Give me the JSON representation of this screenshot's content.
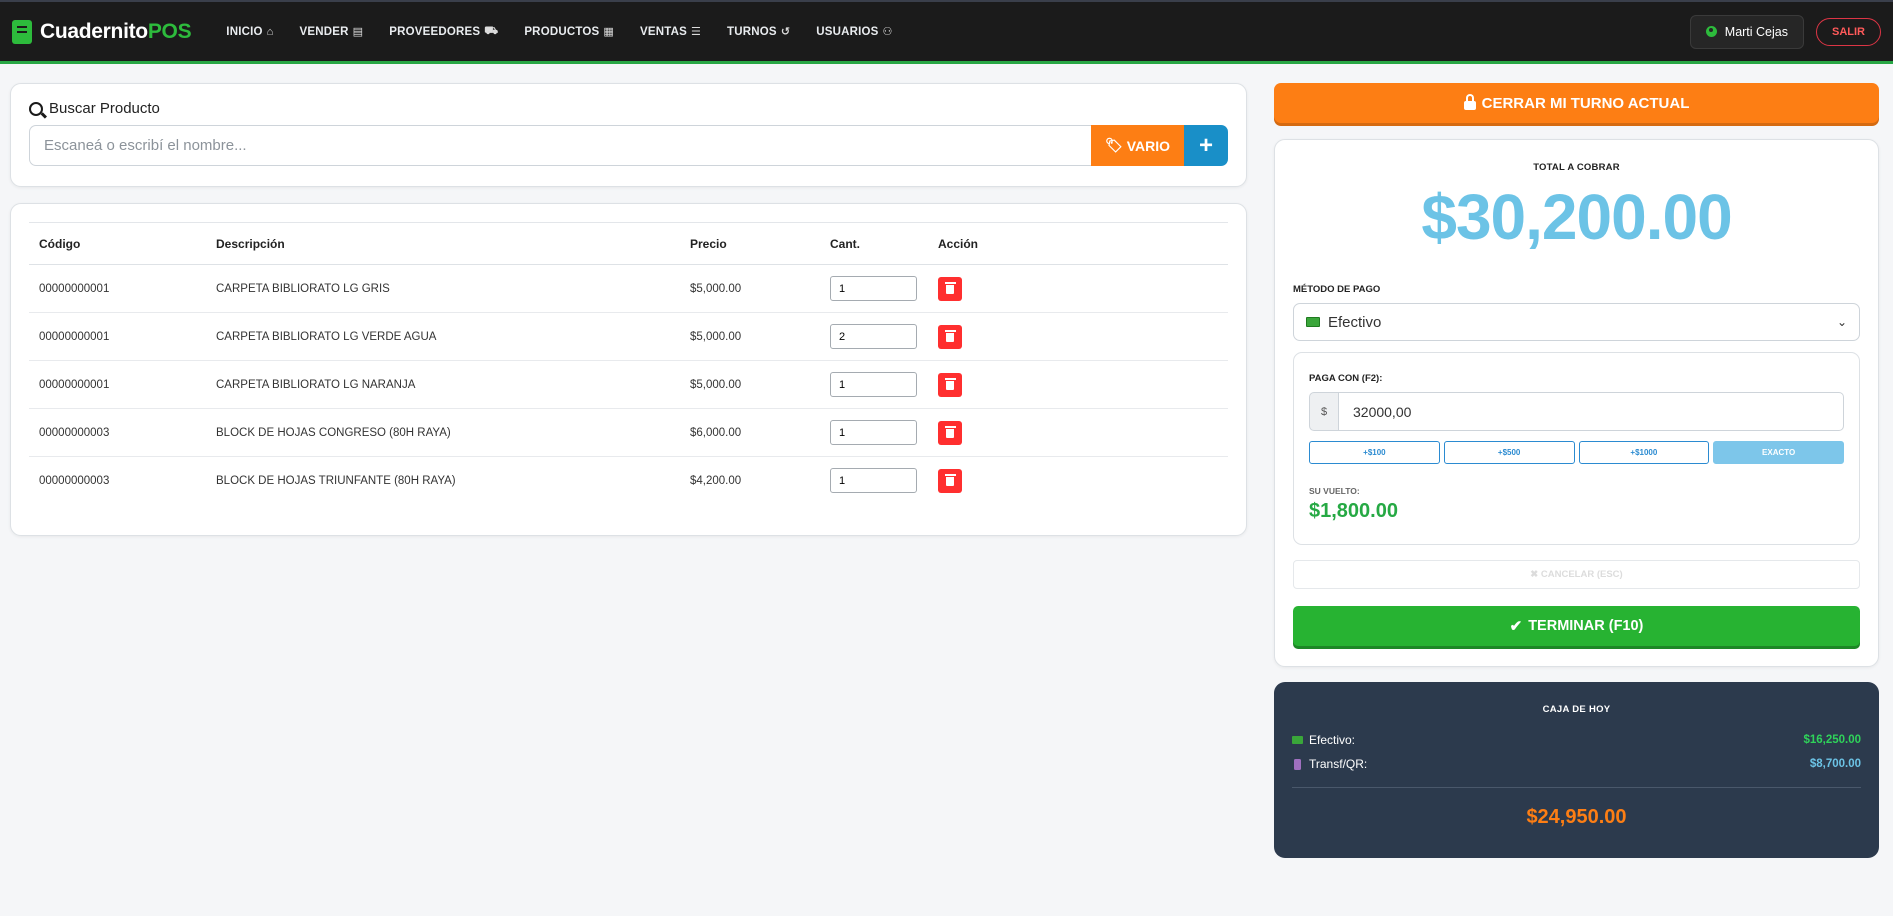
{
  "brand": {
    "name": "Cuadernito",
    "suffix": "POS"
  },
  "nav": [
    {
      "label": "INICIO",
      "icon": "home-icon",
      "glyph": "⌂"
    },
    {
      "label": "VENDER",
      "icon": "cash-register-icon",
      "glyph": "▤"
    },
    {
      "label": "PROVEEDORES",
      "icon": "truck-icon",
      "glyph": "⛟"
    },
    {
      "label": "PRODUCTOS",
      "icon": "box-icon",
      "glyph": "▦"
    },
    {
      "label": "VENTAS",
      "icon": "list-icon",
      "glyph": "☰"
    },
    {
      "label": "TURNOS",
      "icon": "history-icon",
      "glyph": "↺"
    },
    {
      "label": "USUARIOS",
      "icon": "users-icon",
      "glyph": "⚇"
    }
  ],
  "user": {
    "name": "Marti Cejas",
    "logout": "SALIR"
  },
  "search": {
    "title": "Buscar Producto",
    "placeholder": "Escaneá o escribí el nombre...",
    "vario": "VARIO",
    "add": "+"
  },
  "table": {
    "headers": [
      "Código",
      "Descripción",
      "Precio",
      "Cant.",
      "Acción"
    ],
    "rows": [
      {
        "code": "00000000001",
        "desc": "CARPETA BIBLIORATO LG GRIS",
        "price": "$5,000.00",
        "qty": "1"
      },
      {
        "code": "00000000001",
        "desc": "CARPETA BIBLIORATO LG VERDE AGUA",
        "price": "$5,000.00",
        "qty": "2"
      },
      {
        "code": "00000000001",
        "desc": "CARPETA BIBLIORATO LG NARANJA",
        "price": "$5,000.00",
        "qty": "1"
      },
      {
        "code": "00000000003",
        "desc": "BLOCK DE HOJAS CONGRESO (80H RAYA)",
        "price": "$6,000.00",
        "qty": "1"
      },
      {
        "code": "00000000003",
        "desc": "BLOCK DE HOJAS TRIUNFANTE (80H RAYA)",
        "price": "$4,200.00",
        "qty": "1"
      }
    ]
  },
  "shift": {
    "close_label": "CERRAR MI TURNO ACTUAL"
  },
  "payment": {
    "total_label": "TOTAL A COBRAR",
    "total": "$30,200.00",
    "method_label": "MÉTODO DE PAGO",
    "method": "Efectivo",
    "paga_label": "PAGA CON (F2):",
    "currency": "$",
    "paga_value": "32000,00",
    "quick": [
      "+$100",
      "+$500",
      "+$1000",
      "EXACTO"
    ],
    "vuelto_label": "SU VUELTO:",
    "vuelto": "$1,800.00",
    "cancel": "✖ CANCELAR (ESC)",
    "finish": "TERMINAR (F10)"
  },
  "cash": {
    "title": "CAJA DE HOY",
    "efectivo_label": "Efectivo:",
    "efectivo": "$16,250.00",
    "transf_label": "Transf/QR:",
    "transf": "$8,700.00",
    "total": "$24,950.00"
  },
  "colors": {
    "brand_green": "#2dbb3c",
    "orange": "#fd7e14",
    "blue": "#198fc8",
    "danger": "#ff2f2f",
    "total_blue": "#6cc3e6"
  }
}
